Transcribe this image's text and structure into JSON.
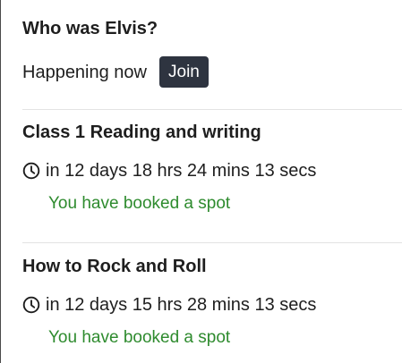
{
  "sessions": [
    {
      "title": "Who was Elvis?",
      "status": "Happening now",
      "join_label": "Join"
    },
    {
      "title": "Class 1 Reading and writing",
      "countdown": "in 12 days 18 hrs 24 mins 13 secs",
      "booked": "You have booked a spot"
    },
    {
      "title": "How to Rock and Roll",
      "countdown": "in 12 days 15 hrs 28 mins 13 secs",
      "booked": "You have booked a spot"
    }
  ],
  "icons": {
    "countdown_icon": "clock-icon"
  },
  "colors": {
    "join_button_bg": "#2e3440",
    "booked_text": "#2e8b2e",
    "divider": "#e3e3e3"
  }
}
